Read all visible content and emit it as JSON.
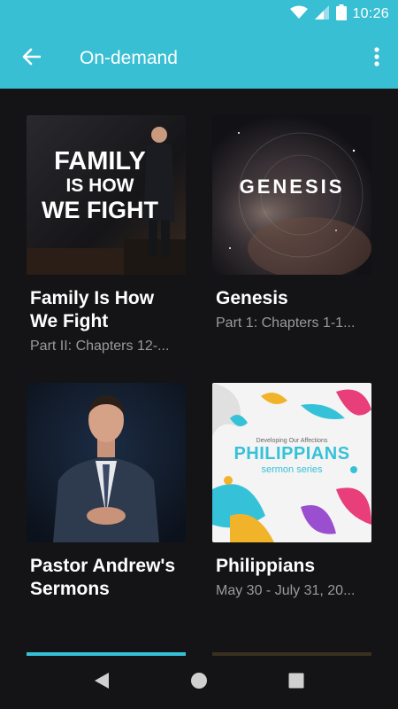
{
  "status_bar": {
    "time": "10:26"
  },
  "app_bar": {
    "title": "On-demand"
  },
  "series": [
    {
      "title": "Family Is How We Fight",
      "subtitle": "Part II: Chapters 12-...",
      "art_lines": [
        "FAMILY",
        "IS HOW",
        "WE FIGHT"
      ]
    },
    {
      "title": "Genesis",
      "subtitle": "Part 1: Chapters 1-1...",
      "art_lines": [
        "GENESIS"
      ]
    },
    {
      "title": "Pastor Andrew's Sermons",
      "subtitle": ""
    },
    {
      "title": "Philippians",
      "subtitle": "May 30 - July 31, 20...",
      "art_lines": [
        "Developing Our Affections",
        "PHILIPPIANS",
        "sermon series"
      ]
    }
  ],
  "colors": {
    "accent": "#39bfd4",
    "background": "#141416",
    "subtitle": "#9a9a9c"
  }
}
